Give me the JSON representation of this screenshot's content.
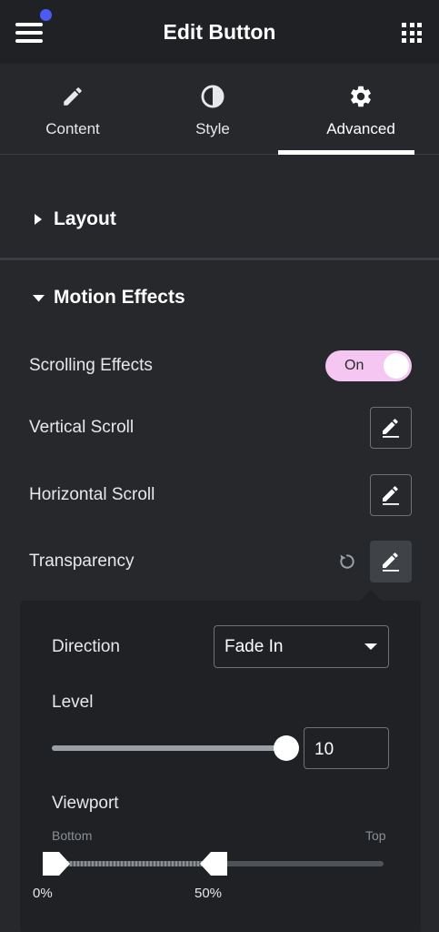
{
  "header": {
    "title": "Edit Button",
    "menu_icon": "hamburger-menu-icon",
    "apps_icon": "apps-grid-icon",
    "notification_color": "#4a5cf5"
  },
  "tabs": [
    {
      "label": "Content",
      "icon": "pencil-icon",
      "active": false
    },
    {
      "label": "Style",
      "icon": "half-circle-icon",
      "active": false
    },
    {
      "label": "Advanced",
      "icon": "gear-icon",
      "active": true
    }
  ],
  "sections": {
    "layout": {
      "title": "Layout",
      "expanded": false
    },
    "motion_effects": {
      "title": "Motion Effects",
      "expanded": true
    }
  },
  "motion": {
    "scrolling_effects": {
      "label": "Scrolling Effects",
      "toggle_text": "On",
      "toggle_on": true,
      "toggle_color": "#f4c6f1"
    },
    "vertical_scroll": {
      "label": "Vertical Scroll"
    },
    "horizontal_scroll": {
      "label": "Horizontal Scroll"
    },
    "transparency": {
      "label": "Transparency"
    }
  },
  "popover": {
    "direction": {
      "label": "Direction",
      "value": "Fade In"
    },
    "level": {
      "label": "Level",
      "value": "10",
      "min": 0,
      "max": 10
    },
    "viewport": {
      "label": "Viewport",
      "bottom_label": "Bottom",
      "top_label": "Top",
      "start_label": "0%",
      "end_label": "50%",
      "start": 0,
      "end": 50
    }
  }
}
